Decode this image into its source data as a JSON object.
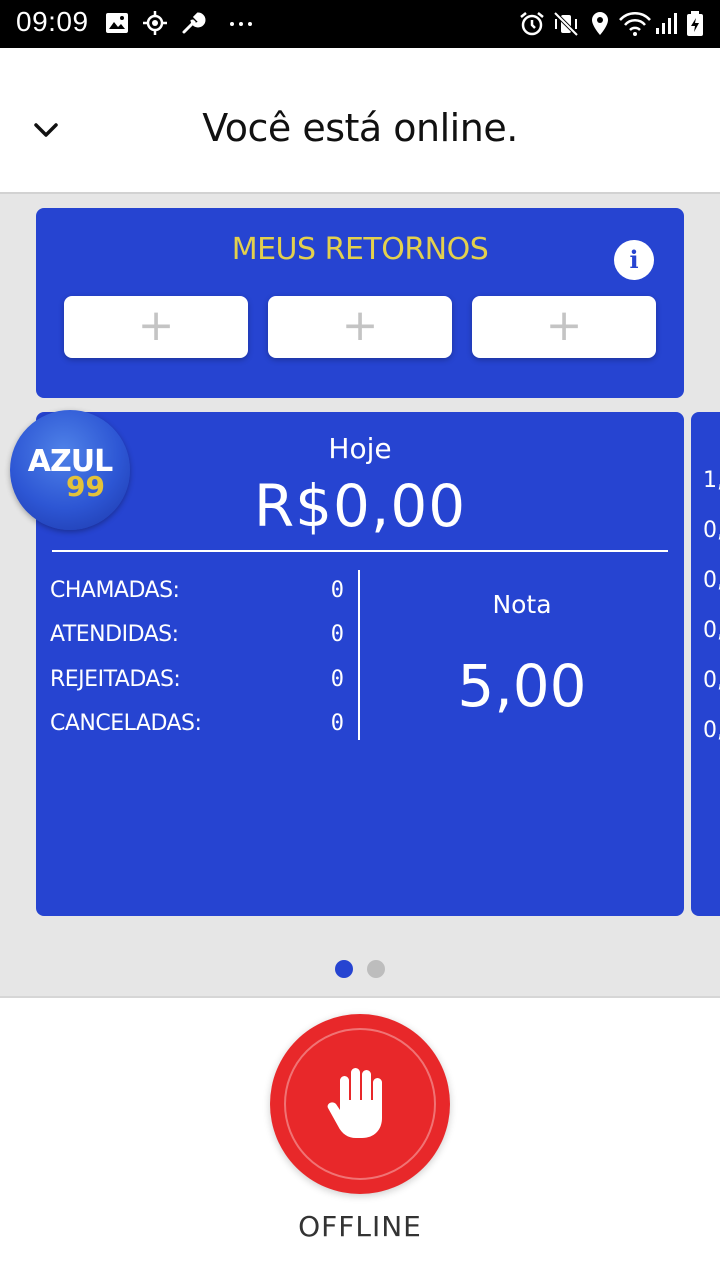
{
  "status_bar": {
    "time": "09:09",
    "left_icons": [
      "image-icon",
      "location-target-icon",
      "wrench-icon",
      "more-dots-icon"
    ],
    "right_icons": [
      "alarm-icon",
      "mute-vibrate-icon",
      "location-pin-icon",
      "wifi-icon",
      "signal-icon",
      "battery-charging-icon"
    ]
  },
  "header": {
    "title": "Você está online.",
    "collapse_icon": "chevron-down-icon"
  },
  "returns": {
    "title": "MEUS RETORNOS",
    "info_label": "i",
    "slots": [
      {
        "label": "+"
      },
      {
        "label": "+"
      },
      {
        "label": "+"
      }
    ]
  },
  "logo": {
    "line1": "AZUL",
    "line2": "99"
  },
  "today": {
    "label": "Hoje",
    "total": "R$0,00",
    "stats": [
      {
        "label": "CHAMADAS:",
        "value": "0"
      },
      {
        "label": "ATENDIDAS:",
        "value": "0"
      },
      {
        "label": "REJEITADAS:",
        "value": "0"
      },
      {
        "label": "CANCELADAS:",
        "value": "0"
      }
    ],
    "rating_label": "Nota",
    "rating_value": "5,00"
  },
  "next_card_peek": [
    "1,",
    "0,",
    "0,",
    "0,",
    "0,",
    "0,"
  ],
  "pager": {
    "count": 2,
    "active": 0,
    "active_color": "#2644d1",
    "inactive_color": "#bdbdbd"
  },
  "offline_button": {
    "label": "OFFLINE",
    "icon": "hand-stop-icon",
    "color": "#e8282a"
  },
  "colors": {
    "card_blue": "#2644d1",
    "accent_yellow": "#e3d04d"
  }
}
